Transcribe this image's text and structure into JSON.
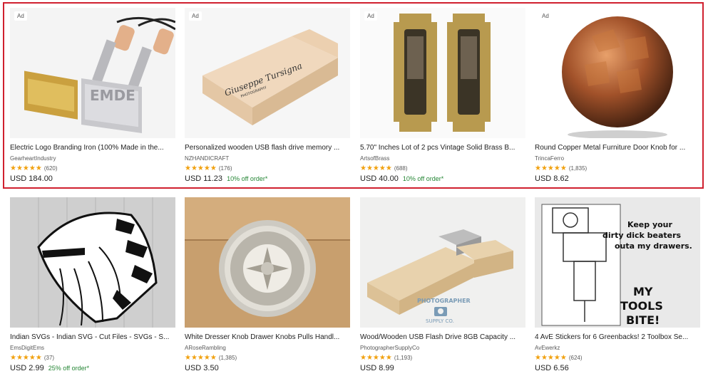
{
  "ad_label": "Ad",
  "row1": [
    {
      "title": "Electric Logo Branding Iron (100% Made in the...",
      "shop": "GearheartIndustry",
      "stars": "★★★★★",
      "count": "(620)",
      "price": "USD 184.00",
      "promo": ""
    },
    {
      "title": "Personalized wooden USB flash drive memory ...",
      "shop": "NZHANDICRAFT",
      "stars": "★★★★★",
      "count": "(176)",
      "price": "USD 11.23",
      "promo": "10% off order*"
    },
    {
      "title": "5.70\" Inches Lot of 2 pcs Vintage Solid Brass B...",
      "shop": "ArtsofBrass",
      "stars": "★★★★★",
      "count": "(688)",
      "price": "USD 40.00",
      "promo": "10% off order*"
    },
    {
      "title": "Round Copper Metal Furniture Door Knob for ...",
      "shop": "TrincaFerro",
      "stars": "★★★★★",
      "count": "(1,835)",
      "price": "USD 8.62",
      "promo": ""
    }
  ],
  "row2": [
    {
      "title": "Indian SVGs - Indian SVG - Cut Files - SVGs - S...",
      "shop": "EmsDigitEms",
      "stars": "★★★★★",
      "count": "(37)",
      "price": "USD 2.99",
      "promo": "25% off order*"
    },
    {
      "title": "White Dresser Knob Drawer Knobs Pulls Handl...",
      "shop": "ARoseRambling",
      "stars": "★★★★★",
      "count": "(1,385)",
      "price": "USD 3.50",
      "promo": ""
    },
    {
      "title": "Wood/Wooden USB Flash Drive 8GB Capacity ...",
      "shop": "PhotographerSupplyCo",
      "stars": "★★★★★",
      "count": "(1,193)",
      "price": "USD 8.99",
      "promo": ""
    },
    {
      "title": "4 AvE Stickers for 6 Greenbacks! 2 Toolbox Se...",
      "shop": "AvEwerkz",
      "stars": "★★★★★",
      "count": "(624)",
      "price": "USD 6.56",
      "promo": ""
    }
  ],
  "images": {
    "usb_logo_script": "Giuseppe Tursigna",
    "usb_logo_sub": "PHOTOGRAPHY",
    "sticker_line1": "Keep your",
    "sticker_line2": "dirty dick beaters",
    "sticker_line3": "outa my drawers.",
    "sticker_big1": "MY",
    "sticker_big2": "TOOLS",
    "sticker_big3": "BITE!",
    "wm_line1": "PHOTOGRAPHER",
    "wm_line2": "SUPPLY CO."
  }
}
